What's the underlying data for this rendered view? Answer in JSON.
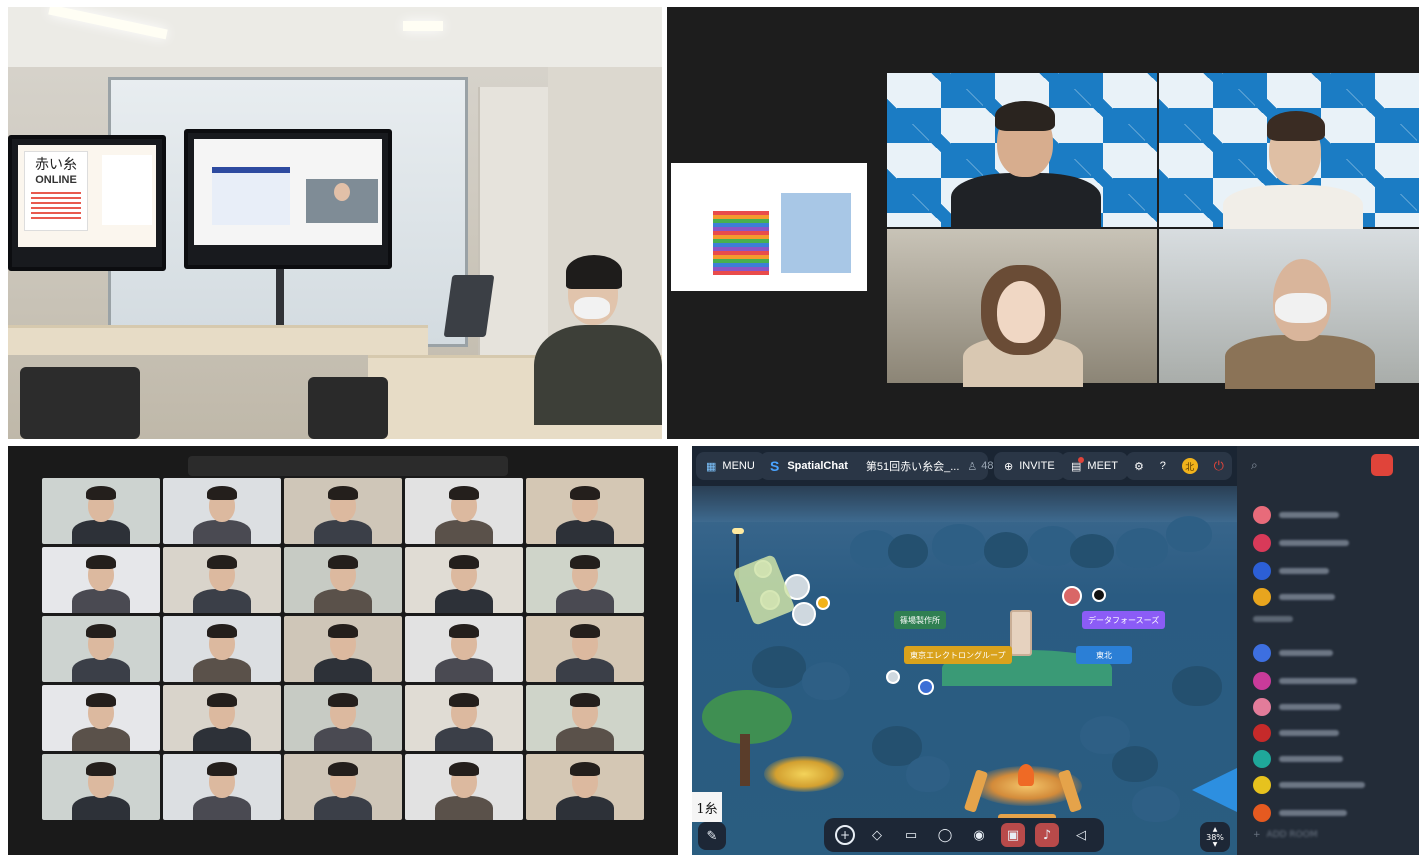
{
  "office_photo": {
    "poster_text": "赤い糸",
    "poster_sub": "ONLINE"
  },
  "spatialchat": {
    "menu_label": "MENU",
    "app_name": "SpatialChat",
    "room_name": "第51回赤い糸会_...",
    "participant_count": "48",
    "invite_label": "INVITE",
    "meet_label": "MEET",
    "zone_labels": [
      "篠場製作所",
      "データフォースーズ",
      "東京エレクトロングループ",
      "東北"
    ],
    "zoom_level": "38%",
    "corner_logo": "1糸",
    "sidebar_add_room": "ADD ROOM",
    "colors": {
      "accent_yellow": "#f2b31b",
      "power_red": "#e0443a",
      "tag_green": "#2f7f52",
      "tag_purple": "#8b5cf6",
      "tag_gold": "#d9a21c",
      "tag_blue": "#2b7fd6"
    }
  }
}
